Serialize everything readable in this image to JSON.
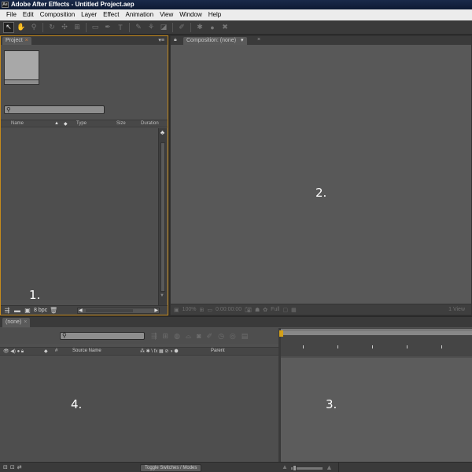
{
  "window": {
    "title": "Adobe After Effects - Untitled Project.aep",
    "app_icon_label": "Ae"
  },
  "menu": [
    "File",
    "Edit",
    "Composition",
    "Layer",
    "Effect",
    "Animation",
    "View",
    "Window",
    "Help"
  ],
  "toolbar": {
    "tools": [
      {
        "name": "selection-tool",
        "glyph": "↖",
        "active": true
      },
      {
        "name": "hand-tool",
        "glyph": "✋"
      },
      {
        "name": "zoom-tool",
        "glyph": "⚲"
      },
      {
        "name": "rotation-tool",
        "glyph": "↻"
      },
      {
        "name": "camera-tool",
        "glyph": "✣"
      },
      {
        "name": "pan-behind-tool",
        "glyph": "⊞"
      },
      {
        "name": "rectangle-tool",
        "glyph": "▭"
      },
      {
        "name": "pen-tool",
        "glyph": "✒"
      },
      {
        "name": "text-tool",
        "glyph": "T"
      },
      {
        "name": "brush-tool",
        "glyph": "✎"
      },
      {
        "name": "clone-stamp-tool",
        "glyph": "⚘"
      },
      {
        "name": "eraser-tool",
        "glyph": "◪"
      },
      {
        "name": "roto-brush-tool",
        "glyph": "✐"
      },
      {
        "name": "puppet-tool",
        "glyph": "✱"
      }
    ]
  },
  "project": {
    "tab_label": "Project",
    "tab_close": "×",
    "columns": [
      "Name",
      "Type",
      "Size",
      "Duration"
    ],
    "bit_depth": "8 bpc",
    "panel_number": "1."
  },
  "composition": {
    "tab_label": "Composition: (none)",
    "tab_dropdown": "▾",
    "tab_close": "×",
    "panel_number": "2.",
    "zoom_level": "100%",
    "timecode": "0:00:00:00",
    "resolution": "Full",
    "view_layout": "1 View"
  },
  "timeline": {
    "tab_label": "(none)",
    "tab_close": "×",
    "columns": [
      "#",
      "Source Name",
      "Parent"
    ],
    "switch_icons": "⁂ ✱ \\ fx ▦ ⊘ ◑ ⬢",
    "toggle_label": "Toggle Switches / Modes",
    "layer_panel_number": "4.",
    "graph_panel_number": "3."
  }
}
